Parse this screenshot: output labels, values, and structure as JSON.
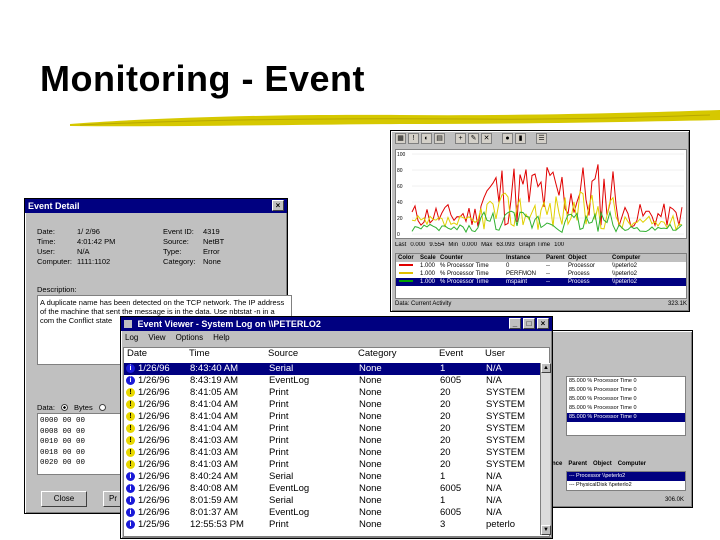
{
  "slide": {
    "title": "Monitoring - Event"
  },
  "perfmon": {
    "y_ticks": [
      "100",
      "80",
      "60",
      "40",
      "20",
      "0"
    ],
    "stats": {
      "last_label": "Last",
      "last_value": "0.000",
      "avg_value": "9.554",
      "min_label": "Min",
      "min_value": "0.000",
      "max_label": "Max",
      "max_value": "63.093",
      "graph_time_label": "Graph Time",
      "graph_time_value": "100"
    },
    "legend_headers": [
      "Color",
      "Scale",
      "Counter",
      "Instance",
      "Parent",
      "Object",
      "Computer"
    ],
    "legend_rows": [
      {
        "scale": "1.000",
        "counter": "% Processor Time",
        "instance": "0",
        "parent": "--",
        "object": "Processor",
        "computer": "\\\\peterlo2",
        "color": "#e00000",
        "selected": false
      },
      {
        "scale": "1.000",
        "counter": "% Processor Time",
        "instance": "PERFMON",
        "parent": "--",
        "object": "Process",
        "computer": "\\\\peterlo2",
        "color": "#e0c000",
        "selected": false
      },
      {
        "scale": "1.000",
        "counter": "% Processor Time",
        "instance": "mspaint",
        "parent": "--",
        "object": "Process",
        "computer": "\\\\peterlo2",
        "color": "#00a000",
        "selected": true
      }
    ],
    "status_left": "Data: Current Activity",
    "status_right": "323.1K",
    "colors": {
      "red": "#e00000",
      "yellow": "#e0d000",
      "green": "#30b030"
    }
  },
  "back_right": {
    "top_rows": [
      {
        "text": "85.000  % Processor Time  0",
        "selected": false
      },
      {
        "text": "85.000  % Processor Time  0",
        "selected": false
      },
      {
        "text": "85.000  % Processor Time  0",
        "selected": false
      },
      {
        "text": "85.000  % Processor Time  0",
        "selected": false
      },
      {
        "text": "85.000  % Processor Time  0",
        "selected": true
      }
    ],
    "headers": [
      "nce",
      "Parent",
      "Object",
      "Computer"
    ],
    "bottom_rows": [
      {
        "text": "---   Processor  \\\\peterlo2",
        "selected": true
      },
      {
        "text": "---   PhysicalDisk  \\\\peterlo2",
        "selected": false
      }
    ],
    "status": "306.0K"
  },
  "event_detail": {
    "title": "Event Detail",
    "fields": {
      "date_label": "Date:",
      "date_value": "1/ 2/96",
      "time_label": "Time:",
      "time_value": "4:01:42 PM",
      "user_label": "User:",
      "user_value": "N/A",
      "computer_label": "Computer:",
      "computer_value": "1111:1102",
      "eventid_label": "Event ID:",
      "eventid_value": "4319",
      "source_label": "Source:",
      "source_value": "NetBT",
      "type_label": "Type:",
      "type_value": "Error",
      "category_label": "Category:",
      "category_value": "None"
    },
    "description_label": "Description:",
    "description": "A duplicate name has been detected on the TCP network. The IP address of the machine that sent the message is in the data. Use nbtstat -n in a com the Conflict state",
    "data_label": "Data:",
    "bytes_label": "Bytes",
    "data_rows": [
      "0000  00 00",
      "0008  00 00",
      "0010  00 00",
      "0018  00 00",
      "0020  00 00"
    ],
    "close_label": "Close",
    "prev_label": "Pr"
  },
  "event_viewer": {
    "title": "Event Viewer - System Log on \\\\PETERLO2",
    "menu": [
      "Log",
      "View",
      "Options",
      "Help"
    ],
    "columns": {
      "date": "Date",
      "time": "Time",
      "source": "Source",
      "category": "Category",
      "event": "Event",
      "user": "User"
    },
    "rows": [
      {
        "icon": "info",
        "date": "1/26/96",
        "time": "8:43:40 AM",
        "source": "Serial",
        "category": "None",
        "event": "1",
        "user": "N/A",
        "selected": true
      },
      {
        "icon": "info",
        "date": "1/26/96",
        "time": "8:43:19 AM",
        "source": "EventLog",
        "category": "None",
        "event": "6005",
        "user": "N/A",
        "selected": false
      },
      {
        "icon": "warn",
        "date": "1/26/96",
        "time": "8:41:05 AM",
        "source": "Print",
        "category": "None",
        "event": "20",
        "user": "SYSTEM",
        "selected": false
      },
      {
        "icon": "warn",
        "date": "1/26/96",
        "time": "8:41:04 AM",
        "source": "Print",
        "category": "None",
        "event": "20",
        "user": "SYSTEM",
        "selected": false
      },
      {
        "icon": "warn",
        "date": "1/26/96",
        "time": "8:41:04 AM",
        "source": "Print",
        "category": "None",
        "event": "20",
        "user": "SYSTEM",
        "selected": false
      },
      {
        "icon": "warn",
        "date": "1/26/96",
        "time": "8:41:04 AM",
        "source": "Print",
        "category": "None",
        "event": "20",
        "user": "SYSTEM",
        "selected": false
      },
      {
        "icon": "warn",
        "date": "1/26/96",
        "time": "8:41:03 AM",
        "source": "Print",
        "category": "None",
        "event": "20",
        "user": "SYSTEM",
        "selected": false
      },
      {
        "icon": "warn",
        "date": "1/26/96",
        "time": "8:41:03 AM",
        "source": "Print",
        "category": "None",
        "event": "20",
        "user": "SYSTEM",
        "selected": false
      },
      {
        "icon": "warn",
        "date": "1/26/96",
        "time": "8:41:03 AM",
        "source": "Print",
        "category": "None",
        "event": "20",
        "user": "SYSTEM",
        "selected": false
      },
      {
        "icon": "info",
        "date": "1/26/96",
        "time": "8:40:24 AM",
        "source": "Serial",
        "category": "None",
        "event": "1",
        "user": "N/A",
        "selected": false
      },
      {
        "icon": "info",
        "date": "1/26/96",
        "time": "8:40:08 AM",
        "source": "EventLog",
        "category": "None",
        "event": "6005",
        "user": "N/A",
        "selected": false
      },
      {
        "icon": "info",
        "date": "1/26/96",
        "time": "8:01:59 AM",
        "source": "Serial",
        "category": "None",
        "event": "1",
        "user": "N/A",
        "selected": false
      },
      {
        "icon": "info",
        "date": "1/26/96",
        "time": "8:01:37 AM",
        "source": "EventLog",
        "category": "None",
        "event": "6005",
        "user": "N/A",
        "selected": false
      },
      {
        "icon": "info",
        "date": "1/25/96",
        "time": "12:55:53 PM",
        "source": "Print",
        "category": "None",
        "event": "3",
        "user": "peterlo",
        "selected": false
      }
    ]
  }
}
